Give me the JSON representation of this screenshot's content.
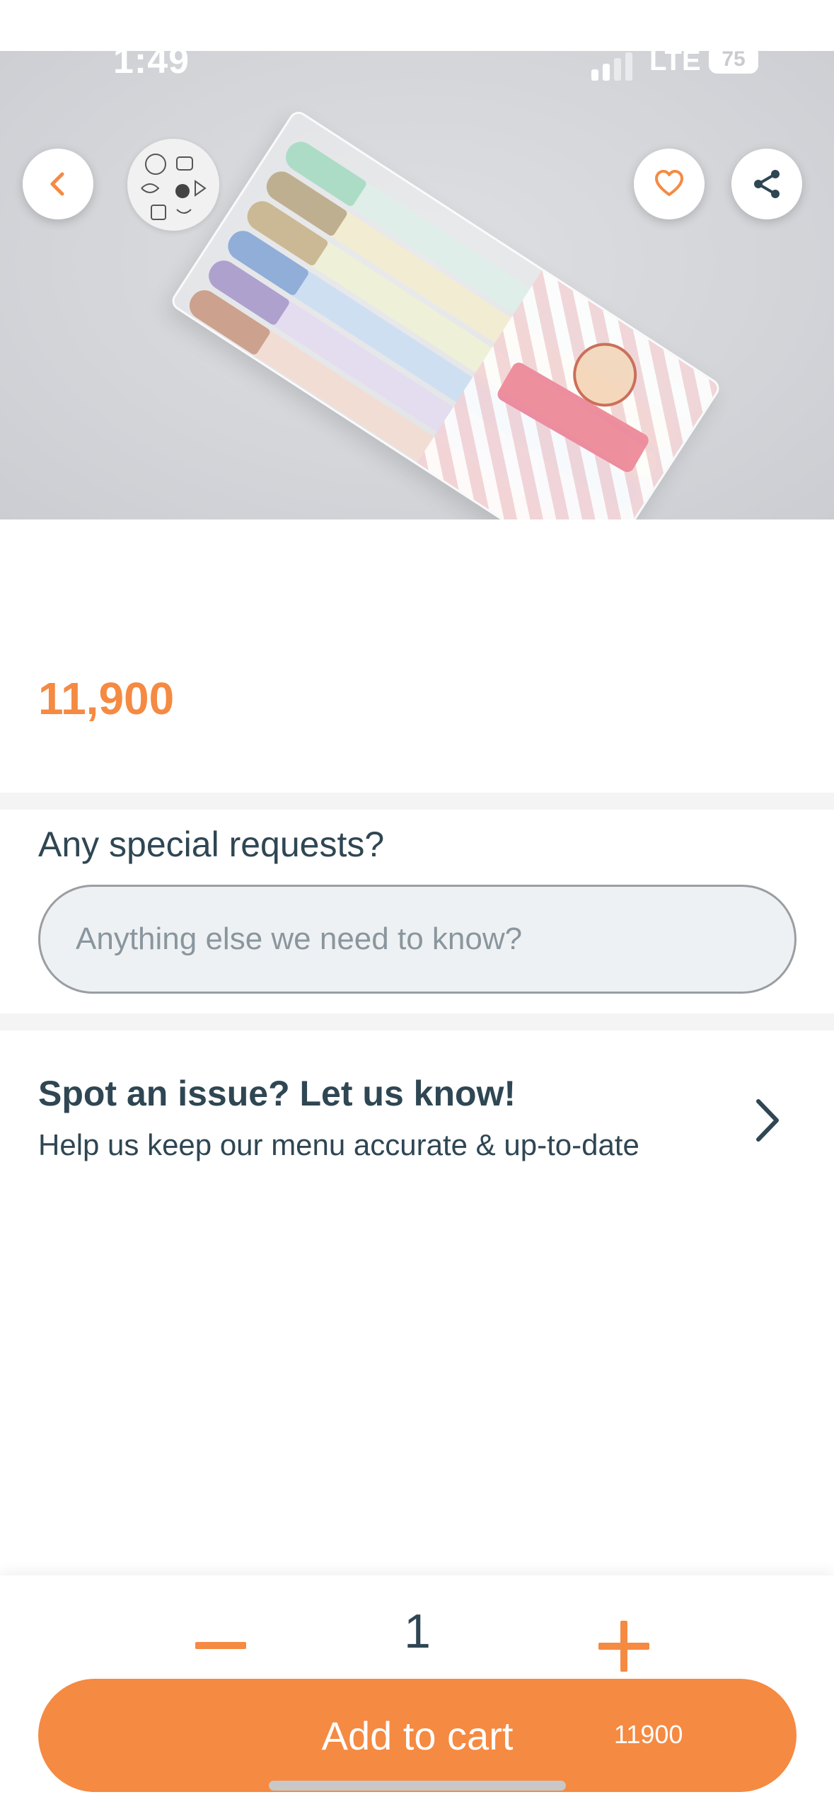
{
  "status_bar": {
    "time": "1:49",
    "network": "LTE",
    "battery": "75"
  },
  "hero": {
    "back_icon": "chevron-left-icon",
    "favorite_icon": "heart-icon",
    "share_icon": "share-icon",
    "accent_color": "#f58a42"
  },
  "product": {
    "price": "11,900"
  },
  "special_requests": {
    "label": "Any special requests?",
    "placeholder": "Anything else we need to know?"
  },
  "issue": {
    "title": "Spot an issue? Let us know!",
    "subtitle": "Help us keep our menu accurate & up-to-date",
    "icon": "chevron-right-icon"
  },
  "cart": {
    "quantity": "1",
    "button_label": "Add to cart",
    "total": "11900",
    "minus_icon": "minus-icon",
    "plus_icon": "plus-icon"
  },
  "colors": {
    "accent": "#f58a42",
    "text": "#2f4653",
    "divider": "#f4f4f4"
  }
}
